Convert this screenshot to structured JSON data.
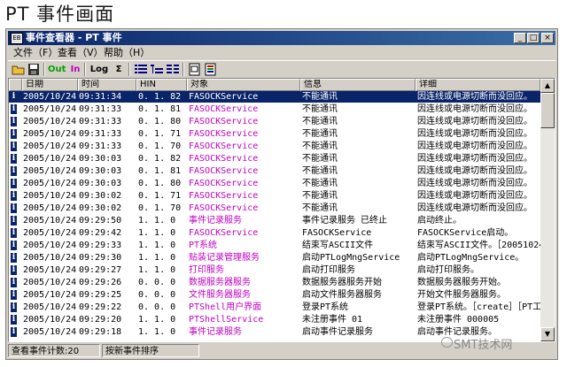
{
  "page_title": "PT 事件画面",
  "window": {
    "title": "事件查看器 - PT 事件",
    "app_icon_text": "EB",
    "controls": {
      "minimize": "_",
      "maximize": "□",
      "close": "×"
    }
  },
  "menu": [
    "文件（F）",
    "查看（V）",
    "帮助（H）"
  ],
  "toolbar": [
    {
      "name": "open-icon",
      "label": ""
    },
    {
      "name": "save-icon",
      "label": ""
    },
    {
      "name": "out-button",
      "label": "Out",
      "color": "#00a000"
    },
    {
      "name": "in-button",
      "label": "In",
      "color": "#c000c0"
    },
    {
      "name": "log-button",
      "label": "Log",
      "color": "#000000"
    },
    {
      "name": "sum-button",
      "label": "Σ",
      "color": "#000000"
    },
    {
      "name": "view-list-icon",
      "label": ""
    },
    {
      "name": "view-tree-icon",
      "label": ""
    },
    {
      "name": "view-detail-icon",
      "label": ""
    },
    {
      "name": "properties-icon",
      "label": ""
    },
    {
      "name": "filter-icon",
      "label": ""
    }
  ],
  "columns": [
    "日期",
    "时间",
    "HIN",
    "对象",
    "信息",
    "详细"
  ],
  "rows": [
    {
      "date": "2005/10/24",
      "time": "09:31:34",
      "hin": "0. 1. 82",
      "object": "FASOCKService",
      "info": "不能通讯",
      "detail": "因连线或电源切断而没回应。",
      "obj_color": "#c000c0",
      "selected": true
    },
    {
      "date": "2005/10/24",
      "time": "09:31:33",
      "hin": "0. 1. 81",
      "object": "FASOCKService",
      "info": "不能通讯",
      "detail": "因连线或电源切断而没回应。",
      "obj_color": "#c000c0"
    },
    {
      "date": "2005/10/24",
      "time": "09:31:33",
      "hin": "0. 1. 80",
      "object": "FASOCKService",
      "info": "不能通讯",
      "detail": "因连线或电源切断而没回应。",
      "obj_color": "#c000c0"
    },
    {
      "date": "2005/10/24",
      "time": "09:31:33",
      "hin": "0. 1. 71",
      "object": "FASOCKService",
      "info": "不能通讯",
      "detail": "因连线或电源切断而没回应。",
      "obj_color": "#c000c0"
    },
    {
      "date": "2005/10/24",
      "time": "09:31:33",
      "hin": "0. 1. 70",
      "object": "FASOCKService",
      "info": "不能通讯",
      "detail": "因连线或电源切断而没回应。",
      "obj_color": "#c000c0"
    },
    {
      "date": "2005/10/24",
      "time": "09:30:03",
      "hin": "0. 1. 82",
      "object": "FASOCKService",
      "info": "不能通讯",
      "detail": "因连线或电源切断而没回应。",
      "obj_color": "#c000c0"
    },
    {
      "date": "2005/10/24",
      "time": "09:30:03",
      "hin": "0. 1. 81",
      "object": "FASOCKService",
      "info": "不能通讯",
      "detail": "因连线或电源切断而没回应。",
      "obj_color": "#c000c0"
    },
    {
      "date": "2005/10/24",
      "time": "09:30:03",
      "hin": "0. 1. 80",
      "object": "FASOCKService",
      "info": "不能通讯",
      "detail": "因连线或电源切断而没回应。",
      "obj_color": "#c000c0"
    },
    {
      "date": "2005/10/24",
      "time": "09:30:02",
      "hin": "0. 1. 71",
      "object": "FASOCKService",
      "info": "不能通讯",
      "detail": "因连线或电源切断而没回应。",
      "obj_color": "#c000c0"
    },
    {
      "date": "2005/10/24",
      "time": "09:30:02",
      "hin": "0. 1. 70",
      "object": "FASOCKService",
      "info": "不能通讯",
      "detail": "因连线或电源切断而没回应。",
      "obj_color": "#c000c0"
    },
    {
      "date": "2005/10/24",
      "time": "09:29:50",
      "hin": "1. 1. 0",
      "object": "事件记录服务",
      "info": "事件记录服务 已终止",
      "detail": "启动终止。",
      "obj_color": "#c000c0"
    },
    {
      "date": "2005/10/24",
      "time": "09:29:42",
      "hin": "1. 1. 0",
      "object": "FASOCKService",
      "info": "FASOCKService",
      "detail": "FASOCKService启动。",
      "obj_color": "#c000c0"
    },
    {
      "date": "2005/10/24",
      "time": "09:29:33",
      "hin": "1. 1. 0",
      "object": "PT系统",
      "info": "结束写ASCII文件",
      "detail": "结束写ASCII文件。［20051024092",
      "obj_color": "#c000c0"
    },
    {
      "date": "2005/10/24",
      "time": "09:29:30",
      "hin": "1. 1. 0",
      "object": "贴装记录管理服务",
      "info": "启动PTLogMngService",
      "detail": "启动PTLogMngService。",
      "obj_color": "#c000c0"
    },
    {
      "date": "2005/10/24",
      "time": "09:29:27",
      "hin": "1. 1. 0",
      "object": "打印服务",
      "info": "启动打印服务",
      "detail": "启动打印服务。",
      "obj_color": "#c000c0"
    },
    {
      "date": "2005/10/24",
      "time": "09:29:26",
      "hin": "0. 0. 0",
      "object": "数据服务器服务",
      "info": "数据服务器服务开始",
      "detail": "数据服务器服务开始。",
      "obj_color": "#c000c0"
    },
    {
      "date": "2005/10/24",
      "time": "09:29:25",
      "hin": "0. 0. 0",
      "object": "文件服务器服务",
      "info": "启动文件服务器服务",
      "detail": "开始文件服务器服务。",
      "obj_color": "#c000c0"
    },
    {
      "date": "2005/10/24",
      "time": "09:29:22",
      "hin": "0. 0. 0",
      "object": "PTShell用户界面",
      "info": "登录PT系统",
      "detail": "登录PT系统。［create］［PT工程师］",
      "obj_color": "#c000c0"
    },
    {
      "date": "2005/10/24",
      "time": "09:29:20",
      "hin": "1. 1. 0",
      "object": "PTShellService",
      "info": "未注册事件 01",
      "detail": "未注册事件 000005",
      "obj_color": "#c000c0"
    },
    {
      "date": "2005/10/24",
      "time": "09:29:18",
      "hin": "1. 1. 0",
      "object": "事件记录服务",
      "info": "启动事件记录服务",
      "detail": "启动事件记录服务。",
      "obj_color": "#c000c0"
    }
  ],
  "status": {
    "count": "查看事件计数:20",
    "sort": "按新事件排序"
  },
  "watermark": "SMT技术网"
}
